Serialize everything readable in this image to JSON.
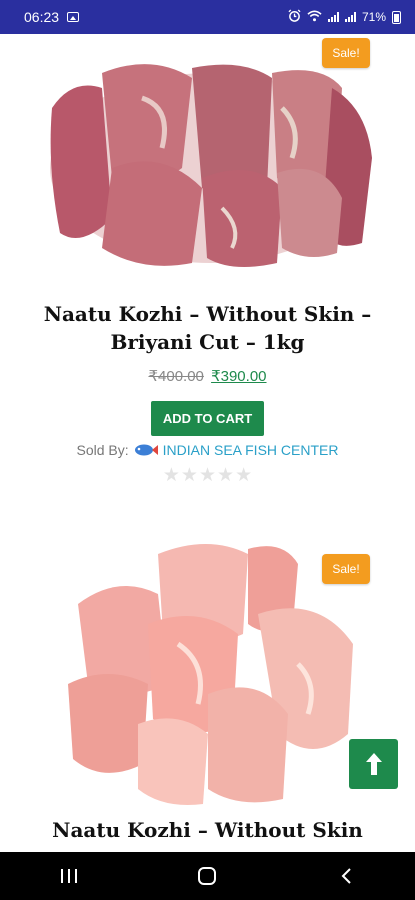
{
  "status_bar": {
    "time": "06:23",
    "battery": "71%",
    "net_label": "4G\nLTE1",
    "icons": [
      "image-icon",
      "alarm-icon",
      "wifi-icon",
      "signal-icon",
      "battery-icon"
    ]
  },
  "products": [
    {
      "badge": "Sale!",
      "title_line1": "Naatu Kozhi – Without Skin –",
      "title_line2": "Briyani Cut – 1kg",
      "old_price": "₹400.00",
      "new_price": "₹390.00",
      "cart_label": "ADD TO CART",
      "sold_by_label": "Sold By:",
      "vendor": "INDIAN SEA FISH CENTER",
      "rating": 0,
      "image": "raw-chicken-pieces"
    },
    {
      "badge": "Sale!",
      "title_line1": "Naatu Kozhi – Without Skin",
      "image": "raw-chicken-cubes"
    }
  ],
  "colors": {
    "status_bar": "#2a2f9f",
    "sale_badge": "#f39c1f",
    "primary_green": "#1e8a4c",
    "vendor_link": "#2aa0c8"
  }
}
